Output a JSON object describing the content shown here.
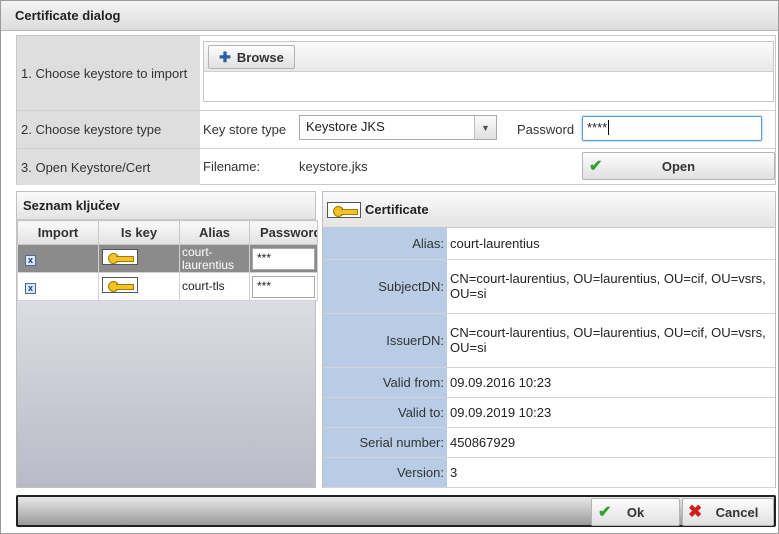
{
  "dialog": {
    "title": "Certificate dialog"
  },
  "steps": {
    "step1_label": "1. Choose keystore to import",
    "browse_label": "Browse",
    "step2_label": "2. Choose keystore type",
    "keystore_type_label": "Key store type",
    "keystore_type_value": "Keystore JKS",
    "password_label": "Password",
    "password_value": "****",
    "step3_label": "3. Open Keystore/Cert",
    "filename_label": "Filename:",
    "filename_value": "keystore.jks",
    "open_label": "Open"
  },
  "keys": {
    "title": "Seznam ključev",
    "columns": [
      "Import",
      "Is key",
      "Alias",
      "Password"
    ],
    "rows": [
      {
        "alias": "court-laurentius",
        "password": "***",
        "selected": true
      },
      {
        "alias": "court-tls",
        "password": "***",
        "selected": false
      }
    ]
  },
  "certificate": {
    "title": "Certificate",
    "fields": [
      {
        "key": "Alias:",
        "value": "court-laurentius"
      },
      {
        "key": "SubjectDN:",
        "value": "CN=court-laurentius, OU=laurentius, OU=cif, OU=vsrs, OU=si"
      },
      {
        "key": "IssuerDN:",
        "value": "CN=court-laurentius, OU=laurentius, OU=cif, OU=vsrs, OU=si"
      },
      {
        "key": "Valid from:",
        "value": "09.09.2016 10:23"
      },
      {
        "key": "Valid to:",
        "value": "09.09.2019 10:23"
      },
      {
        "key": "Serial number:",
        "value": "450867929"
      },
      {
        "key": "Version:",
        "value": "3"
      }
    ]
  },
  "footer": {
    "ok_label": "Ok",
    "cancel_label": "Cancel"
  },
  "icons": {
    "browse": "plus-icon",
    "dropdown": "chevron-down-icon",
    "open": "checkmark-icon",
    "import": "checkbox-icon",
    "key": "key-icon",
    "ok": "checkmark-icon",
    "cancel": "close-icon"
  },
  "colors": {
    "accent": "#5b97d6",
    "label_bg": "#b9cce6",
    "selected_row": "#8b8b8b",
    "ok_check": "#35a030",
    "cancel_x": "#d0201c"
  }
}
